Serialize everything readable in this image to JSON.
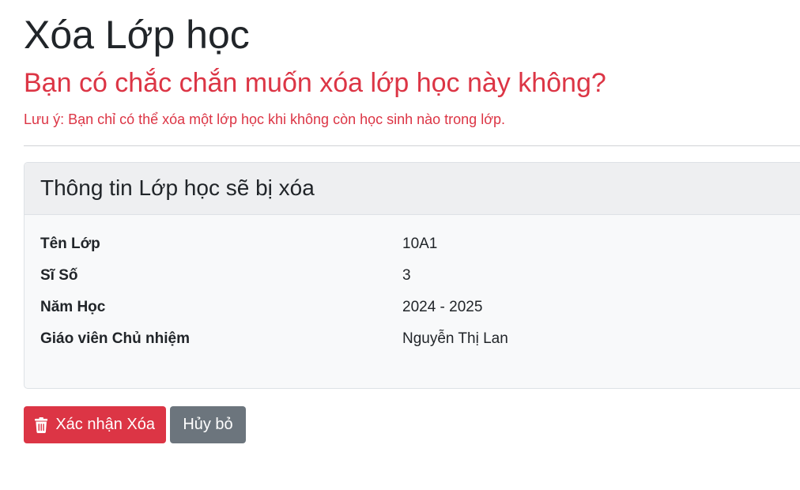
{
  "page": {
    "title": "Xóa Lớp học",
    "question": "Bạn có chắc chắn muốn xóa lớp học này không?",
    "note": "Lưu ý: Bạn chỉ có thể xóa một lớp học khi không còn học sinh nào trong lớp."
  },
  "card": {
    "title": "Thông tin Lớp học sẽ bị xóa",
    "rows": [
      {
        "label": "Tên Lớp",
        "value": "10A1"
      },
      {
        "label": "Sĩ Số",
        "value": "3"
      },
      {
        "label": "Năm Học",
        "value": "2024 - 2025"
      },
      {
        "label": "Giáo viên Chủ nhiệm",
        "value": "Nguyễn Thị Lan"
      }
    ]
  },
  "actions": {
    "confirm_label": "Xác nhận Xóa",
    "confirm_icon": "trash-icon",
    "cancel_label": "Hủy bỏ"
  },
  "colors": {
    "danger": "#dc3545",
    "secondary": "#6c757d",
    "card_header": "#eeeff1",
    "card_body": "#f8f9fa"
  }
}
